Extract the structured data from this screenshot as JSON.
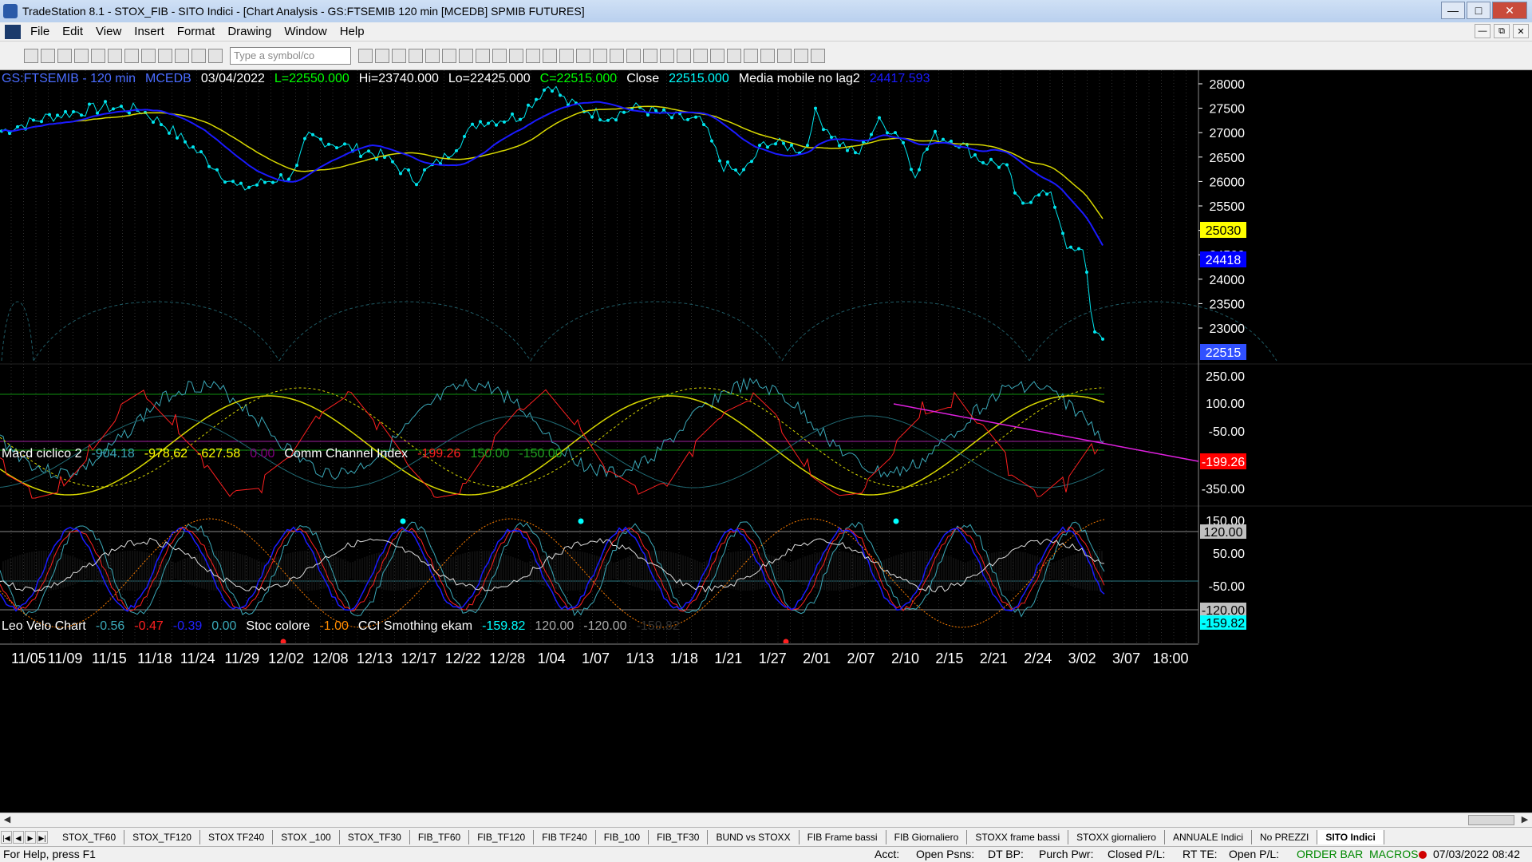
{
  "window": {
    "title": "TradeStation 8.1 - STOX_FIB - SITO Indici - [Chart Analysis - GS:FTSEMIB  120 min  [MCEDB] SPMIB FUTURES]"
  },
  "menu": [
    "File",
    "Edit",
    "View",
    "Insert",
    "Format",
    "Drawing",
    "Window",
    "Help"
  ],
  "toolbar": {
    "symbol_placeholder": "Type a symbol/co"
  },
  "chart": {
    "main_info": [
      {
        "text": "GS:FTSEMIB - 120 min",
        "color": "#4a6cff"
      },
      {
        "text": "MCEDB",
        "color": "#4a6cff"
      },
      {
        "text": "03/04/2022",
        "color": "#ffffff"
      },
      {
        "text": "L=22550.000",
        "color": "#00ff00"
      },
      {
        "text": "Hi=23740.000",
        "color": "#ffffff"
      },
      {
        "text": "Lo=22425.000",
        "color": "#ffffff"
      },
      {
        "text": "C=22515.000",
        "color": "#00ff00"
      },
      {
        "text": "Close",
        "color": "#ffffff"
      },
      {
        "text": "22515.000",
        "color": "#00ffff"
      },
      {
        "text": "Media mobile no lag2",
        "color": "#ffffff"
      },
      {
        "text": "24417.593",
        "color": "#1a1aff"
      }
    ],
    "macd_info": [
      {
        "text": "Macd ciclico 2",
        "color": "#ffffff"
      },
      {
        "text": "-904.18",
        "color": "#3aa8b8"
      },
      {
        "text": "-978.62",
        "color": "#ffff00"
      },
      {
        "text": "-627.58",
        "color": "#ffff00"
      },
      {
        "text": "0.00",
        "color": "#800080"
      },
      {
        "text": "Comm Channel Index",
        "color": "#ffffff"
      },
      {
        "text": "-199.26",
        "color": "#ff2020"
      },
      {
        "text": "150.00",
        "color": "#20a020"
      },
      {
        "text": "-150.00",
        "color": "#20a020"
      }
    ],
    "velo_info": [
      {
        "text": "Leo Velo Chart",
        "color": "#ffffff"
      },
      {
        "text": "-0.56",
        "color": "#3aa8b8"
      },
      {
        "text": "-0.47",
        "color": "#ff2020"
      },
      {
        "text": "-0.39",
        "color": "#2020ff"
      },
      {
        "text": "0.00",
        "color": "#3aa8b8"
      },
      {
        "text": "Stoc colore",
        "color": "#ffffff"
      },
      {
        "text": "-1.00",
        "color": "#ff8c00"
      },
      {
        "text": "CCI Smothing ekam",
        "color": "#ffffff"
      },
      {
        "text": "-159.82",
        "color": "#00ffff"
      },
      {
        "text": "120.00",
        "color": "#aaaaaa"
      },
      {
        "text": "-120.00",
        "color": "#aaaaaa"
      },
      {
        "text": "-159.82",
        "color": "#333333"
      }
    ],
    "price_axis": [
      "28000",
      "27500",
      "27000",
      "26500",
      "26000",
      "25500",
      "25000",
      "24500",
      "24000",
      "23500",
      "23000"
    ],
    "price_tags": [
      {
        "text": "25030",
        "bg": "#ffff00",
        "fg": "#000000"
      },
      {
        "text": "24418",
        "bg": "#0000ff",
        "fg": "#ffffff"
      },
      {
        "text": "22515",
        "bg": "#3050ff",
        "fg": "#ffffff"
      }
    ],
    "macd_axis": [
      "250.00",
      "100.00",
      "-50.00",
      "-350.00"
    ],
    "macd_tag": {
      "text": "-199.26",
      "bg": "#ff0000",
      "fg": "#ffffff"
    },
    "velo_axis": [
      "150.00",
      "50.00",
      "-50.00"
    ],
    "velo_tags": [
      {
        "text": "120.00",
        "bg": "#c0c0c0",
        "fg": "#000000"
      },
      {
        "text": "-120.00",
        "bg": "#c0c0c0",
        "fg": "#000000"
      },
      {
        "text": "-159.82",
        "bg": "#00ffff",
        "fg": "#000000"
      }
    ],
    "date_axis": [
      "11/05",
      "11/09",
      "11/15",
      "11/18",
      "11/24",
      "11/29",
      "12/02",
      "12/08",
      "12/13",
      "12/17",
      "12/22",
      "12/28",
      "1/04",
      "1/07",
      "1/13",
      "1/18",
      "1/21",
      "1/27",
      "2/01",
      "2/07",
      "2/10",
      "2/15",
      "2/21",
      "2/24",
      "3/02",
      "3/07",
      "18:00"
    ],
    "colors": {
      "price": "#00e5ee",
      "ma_blue": "#1a1aff",
      "ma_yellow": "#d8d800",
      "macd_cyan": "#3aa8b8",
      "cci": "#ff2020",
      "magenta": "#e020e0",
      "green": "#109010",
      "grid": "#303030"
    }
  },
  "tabs": [
    "STOX_TF60",
    "STOX_TF120",
    "STOX TF240",
    "STOX _100",
    "STOX_TF30",
    "FIB_TF60",
    "FIB_TF120",
    "FIB TF240",
    "FIB_100",
    "FIB_TF30",
    "BUND vs STOXX",
    "FIB Frame bassi",
    "FIB Giornaliero",
    "STOXX frame bassi",
    "STOXX giornaliero",
    "ANNUALE Indici",
    "No PREZZI",
    "SITO Indici"
  ],
  "status": {
    "help": "For Help, press F1",
    "acct": "Acct:",
    "open_psns": "Open Psns:",
    "dt_bp": "DT BP:",
    "purch_pwr": "Purch Pwr:",
    "closed_pl": "Closed P/L:",
    "rt_te": "RT TE:",
    "open_pl": "Open P/L:",
    "order_bar": "ORDER BAR",
    "macros": "MACROS",
    "datetime": "07/03/2022 08:42"
  }
}
